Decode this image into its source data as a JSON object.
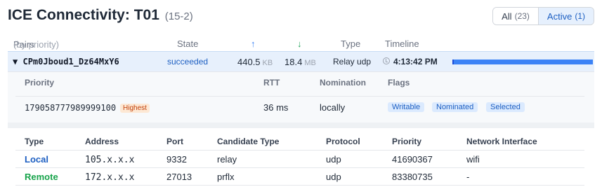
{
  "header": {
    "title": "ICE Connectivity: T01",
    "subtitle": "(15-2)",
    "filter": {
      "all_label": "All",
      "all_count": "(23)",
      "active_label": "Active",
      "active_count": "(1)"
    }
  },
  "columns": {
    "pairs": "Pairs",
    "pairs_hint": "(by priority)",
    "state": "State",
    "up_arrow": "↑",
    "down_arrow": "↓",
    "type": "Type",
    "timeline": "Timeline"
  },
  "pair": {
    "expand_glyph": "▼",
    "name": "CPm0Jboud1_Dz64MxY6",
    "state": "succeeded",
    "sent_value": "440.5",
    "sent_unit": "KB",
    "recv_value": "18.4",
    "recv_unit": "MB",
    "type": "Relay udp",
    "time": "4:13:42 PM",
    "timeline_fraction": 1.0
  },
  "details": {
    "headers": {
      "priority": "Priority",
      "rtt": "RTT",
      "nomination": "Nomination",
      "flags": "Flags"
    },
    "priority": "179058777989999100",
    "priority_badge": "Highest",
    "rtt": "36 ms",
    "nomination": "locally",
    "flags": [
      "Writable",
      "Nominated",
      "Selected"
    ]
  },
  "candidates": {
    "headers": {
      "type": "Type",
      "address": "Address",
      "port": "Port",
      "candidate_type": "Candidate Type",
      "protocol": "Protocol",
      "priority": "Priority",
      "network_interface": "Network Interface"
    },
    "rows": [
      {
        "type": "Local",
        "address": "105.x.x.x",
        "port": "9332",
        "candidate_type": "relay",
        "protocol": "udp",
        "priority": "41690367",
        "network_interface": "wifi"
      },
      {
        "type": "Remote",
        "address": "172.x.x.x",
        "port": "27013",
        "candidate_type": "prflx",
        "protocol": "udp",
        "priority": "83380735",
        "network_interface": "-"
      }
    ]
  },
  "colors": {
    "accent": "#1d5fc2",
    "remote": "#16a34a",
    "row_highlight": "#e7f0fc",
    "badge_bg": "#fde8d4"
  }
}
